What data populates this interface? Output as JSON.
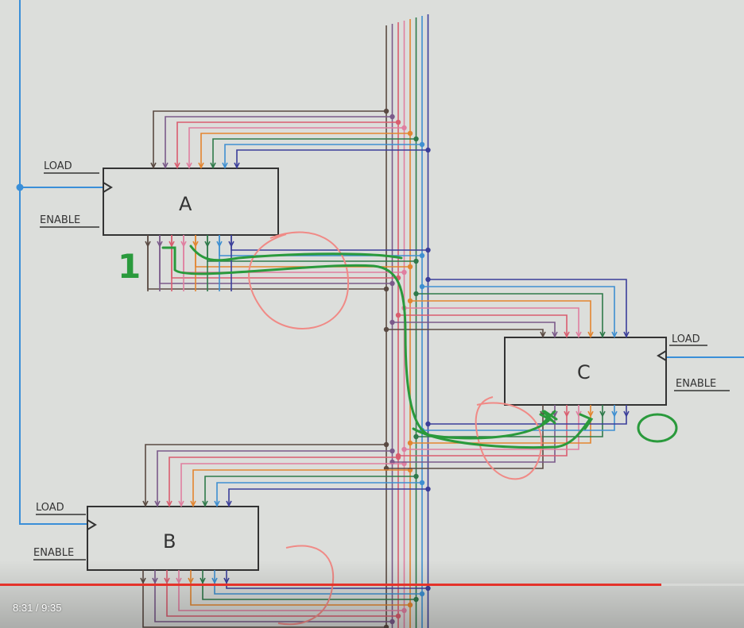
{
  "video": {
    "time_display": "8:31 / 9:35",
    "progress_fraction": 0.889,
    "progress_color": "#e4332a"
  },
  "diagram": {
    "register_a": {
      "name": "A",
      "load_label": "LOAD",
      "enable_label": "ENABLE"
    },
    "register_b": {
      "name": "B",
      "load_label": "LOAD",
      "enable_label": "ENABLE"
    },
    "register_c": {
      "name": "C",
      "load_label": "LOAD",
      "enable_label": "ENABLE"
    },
    "bit_annotation_a": "1",
    "bit_annotation_c": "0",
    "bus_colors": [
      "#5a4a42",
      "#7b5a8a",
      "#d95d6f",
      "#e07fa0",
      "#e3852f",
      "#2f7a4a",
      "#3e8fd1",
      "#3b3f9a"
    ],
    "annotation_colors": {
      "data_path": "#2a9a3c",
      "highlight": "#f08a86",
      "control_line": "#3a8fd8"
    }
  }
}
